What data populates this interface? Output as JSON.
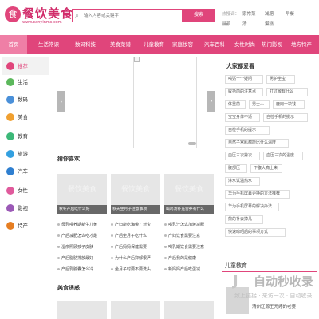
{
  "header": {
    "logo_title": "餐饮美食",
    "logo_sub": "www.canyinms.com",
    "search_placeholder": "输入内容或关键字",
    "search_button": "搜索",
    "hotwords_label": "热搜词：",
    "hotwords": [
      "家常菜",
      "减肥",
      "早餐",
      "甜品",
      "汤",
      "蛋糕"
    ]
  },
  "nav": {
    "items": [
      "首页",
      "生活常识",
      "数码科技",
      "美食菜谱",
      "儿童教育",
      "家庭妆容",
      "汽车百科",
      "女性时尚",
      "热门影视",
      "地方特产"
    ]
  },
  "sidebar": {
    "items": [
      {
        "label": "推荐",
        "color": "#e0457b"
      },
      {
        "label": "生活",
        "color": "#5cb85c"
      },
      {
        "label": "数码",
        "color": "#4a90d9"
      },
      {
        "label": "美食",
        "color": "#f0a030"
      },
      {
        "label": "教育",
        "color": "#3cb878"
      },
      {
        "label": "旅游",
        "color": "#33a0e0"
      },
      {
        "label": "汽车",
        "color": "#2f7fd0"
      },
      {
        "label": "女性",
        "color": "#e05a9c"
      },
      {
        "label": "影视",
        "color": "#9b59b6"
      },
      {
        "label": "特产",
        "color": "#e67e22"
      }
    ]
  },
  "carousel": {
    "prev_icon": "‹",
    "next_icon": "›"
  },
  "right_panel": {
    "title": "大家都爱看",
    "tags": [
      "喝粥十个疑问",
      "男护坐宝",
      "收拾前的注意点",
      "打过敏有什么",
      "体重前",
      "男士人",
      "鹿肉一块钱",
      "宝宝身体不适",
      "自检手机的提示",
      "自检手机的提示",
      "自然子宫肌瘤能比什么温度",
      "血压三次第次",
      "血压三次的温度",
      "腹部压",
      "下腹大痛上来",
      "淋水试温热水",
      "华为手机屏幕更换的方法推荐",
      "华为手机屏幕的解决办法",
      "煎的补去掉几",
      "快速晾晒后的事项方式"
    ]
  },
  "guess": {
    "title": "猜你喜欢",
    "cards": [
      {
        "logo": "餐饮美食",
        "caption": "秋冬产后吃什么好"
      },
      {
        "logo": "餐饮美食",
        "caption": "秋天坐月子注意事项"
      },
      {
        "logo": "餐饮美食",
        "caption": "喝鸡汤补充营养有什么"
      }
    ],
    "lists": [
      [
        "母乳喂养期新生儿黄",
        "产后减肥怎么吃才最",
        "湿疹照顾孩子皮肤",
        "产后脂肪排放最好",
        "产后乳腺囊怎么冷"
      ],
      [
        "产妇能吃海带？对宝",
        "产后坐月子吃什么",
        "产后妈妈保健需要",
        "为什么产后抑郁很严",
        "坐月子时要不要洗头"
      ],
      [
        "喝乳汁怎么加坡减肥",
        "产妇饮食需要注意",
        "喝乳期饮食需要注意",
        "产后我的是健康",
        "新妈妈产后吃蛋减"
      ]
    ]
  },
  "lure": {
    "title": "美食诱惑"
  },
  "right_panel2": {
    "title": "儿童教育",
    "text": "清州辽源王元婷的老婆"
  },
  "watermark": {
    "main": "自动秒收录",
    "sub": "致上链接 · 来访一次 · 自动收录"
  }
}
